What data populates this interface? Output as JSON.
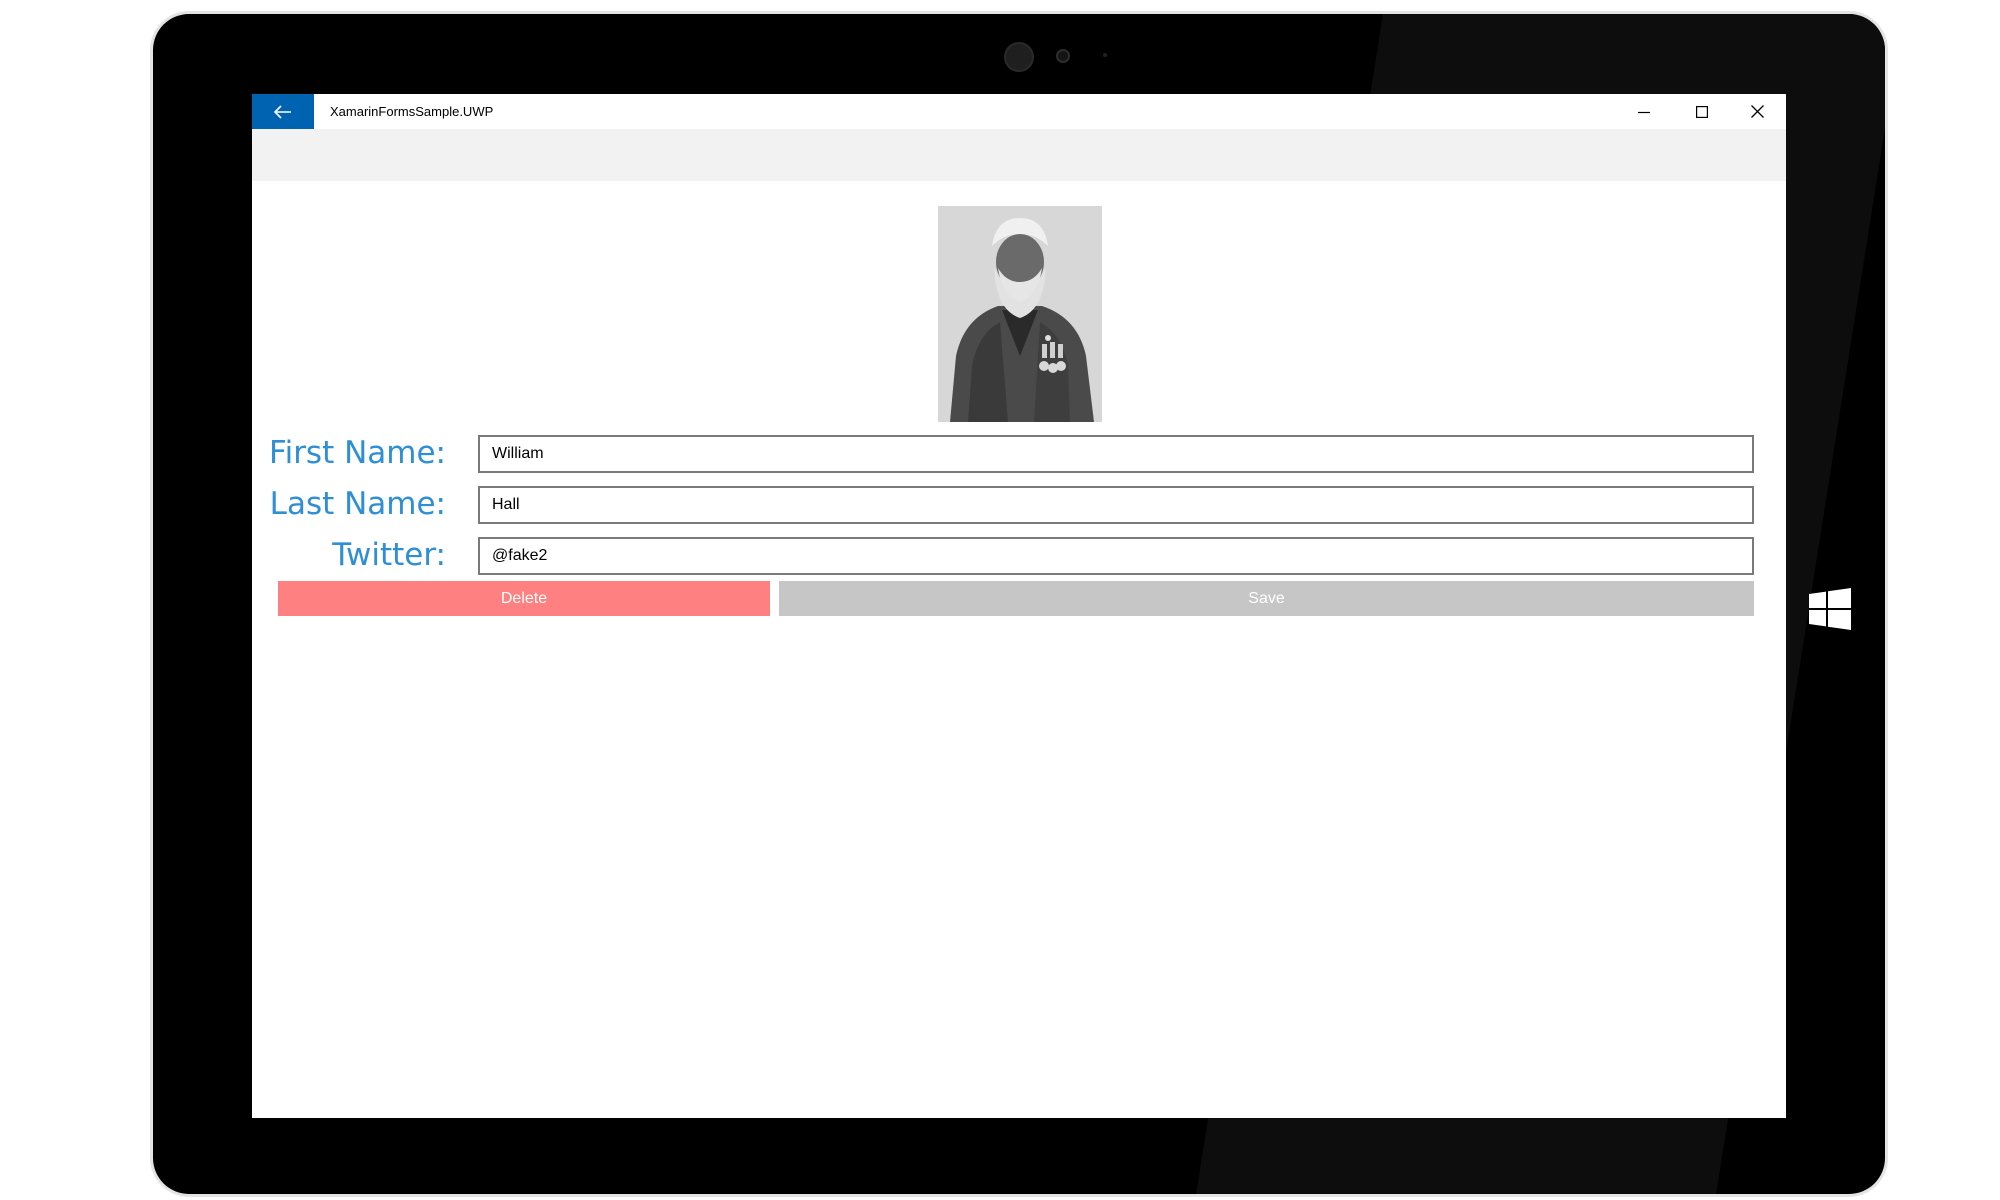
{
  "window": {
    "title": "XamarinFormsSample.UWP",
    "back_icon": "arrow-left-icon",
    "accent": "#0063b1"
  },
  "form": {
    "first_name_label": "First Name:",
    "first_name_value": "William",
    "last_name_label": "Last Name:",
    "last_name_value": "Hall",
    "twitter_label": "Twitter:",
    "twitter_value": "@fake2",
    "label_color": "#2e8fd5"
  },
  "buttons": {
    "delete_label": "Delete",
    "delete_color": "#ff8080",
    "save_label": "Save",
    "save_color": "#c6c6c6"
  },
  "photo": {
    "subject": "portrait-photo"
  }
}
